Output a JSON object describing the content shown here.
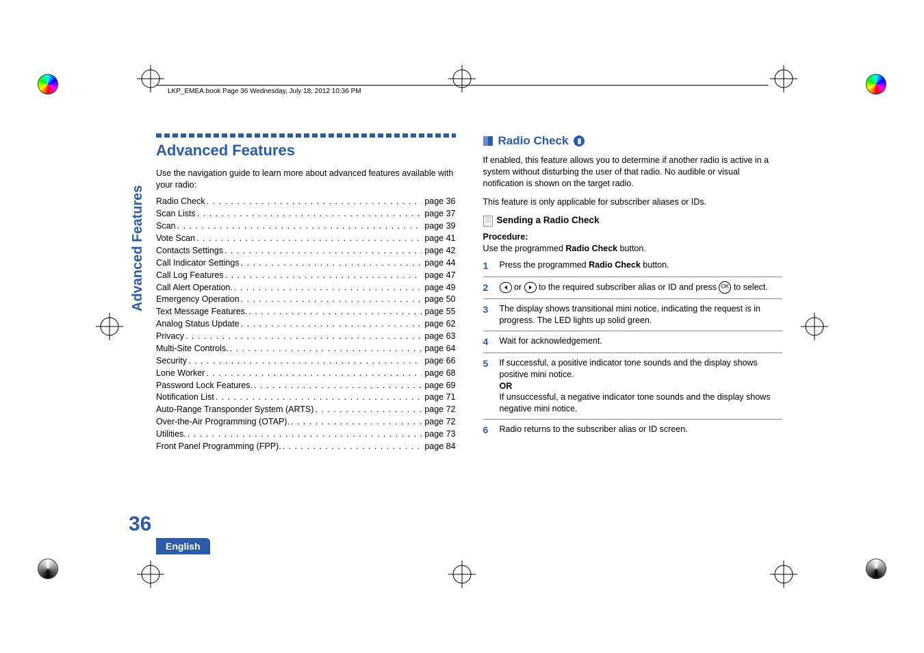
{
  "header": {
    "running": "LKP_EMEA.book  Page 36  Wednesday, July 18, 2012  10:36 PM"
  },
  "sideTab": "Advanced Features",
  "pageNumber": "36",
  "footerTab": "English",
  "left": {
    "title": "Advanced Features",
    "intro": "Use the navigation guide to learn more about advanced features available with your radio:",
    "toc": [
      {
        "label": "Radio Check",
        "page": "page 36"
      },
      {
        "label": "Scan Lists",
        "page": "page 37"
      },
      {
        "label": "Scan",
        "page": "page 39"
      },
      {
        "label": "Vote Scan",
        "page": "page 41"
      },
      {
        "label": "Contacts Settings",
        "page": "page 42"
      },
      {
        "label": "Call Indicator Settings",
        "page": "page 44"
      },
      {
        "label": "Call Log Features",
        "page": "page 47"
      },
      {
        "label": "Call Alert Operation.",
        "page": "page 49"
      },
      {
        "label": "Emergency Operation",
        "page": "page 50"
      },
      {
        "label": "Text Message Features.",
        "page": "page 55"
      },
      {
        "label": "Analog Status Update",
        "page": "page 62"
      },
      {
        "label": "Privacy",
        "page": "page 63"
      },
      {
        "label": "Multi-Site Controls.",
        "page": "page 64"
      },
      {
        "label": "Security",
        "page": "page 66"
      },
      {
        "label": "Lone Worker",
        "page": "page 68"
      },
      {
        "label": "Password Lock Features.",
        "page": "page 69"
      },
      {
        "label": "Notification List",
        "page": "page 71"
      },
      {
        "label": "Auto-Range Transponder System (ARTS)",
        "page": "page 72"
      },
      {
        "label": "Over-the-Air Programming (OTAP).",
        "page": "page 72"
      },
      {
        "label": "Utilities.",
        "page": "page 73"
      },
      {
        "label": "Front Panel Programming (FPP).",
        "page": "page 84"
      }
    ]
  },
  "right": {
    "heading": "Radio Check",
    "p1": "If enabled, this feature allows you to determine if another radio is active in a system without disturbing the user of that radio. No audible or visual notification is shown on the target radio.",
    "p2": "This feature is only applicable for subscriber aliases or IDs.",
    "sub": "Sending a Radio Check",
    "procLabel": "Procedure:",
    "procLine": "Use the programmed ",
    "procBold": "Radio Check",
    "procTail": " button.",
    "steps": {
      "s1a": "Press the programmed ",
      "s1b": "Radio Check",
      "s1c": " button.",
      "s2a": " or ",
      "s2b": " to the required subscriber alias or ID and press ",
      "s2c": " to select.",
      "s3": "The display shows transitional mini notice, indicating the request is in progress. The LED lights up solid green.",
      "s4": "Wait for acknowledgement.",
      "s5a": "If successful, a positive indicator tone sounds and the display shows positive mini notice.",
      "s5or": "OR",
      "s5b": "If unsuccessful, a negative indicator tone sounds and the display shows negative mini notice.",
      "s6": "Radio returns to the subscriber alias or ID screen."
    },
    "ok": "OK"
  }
}
